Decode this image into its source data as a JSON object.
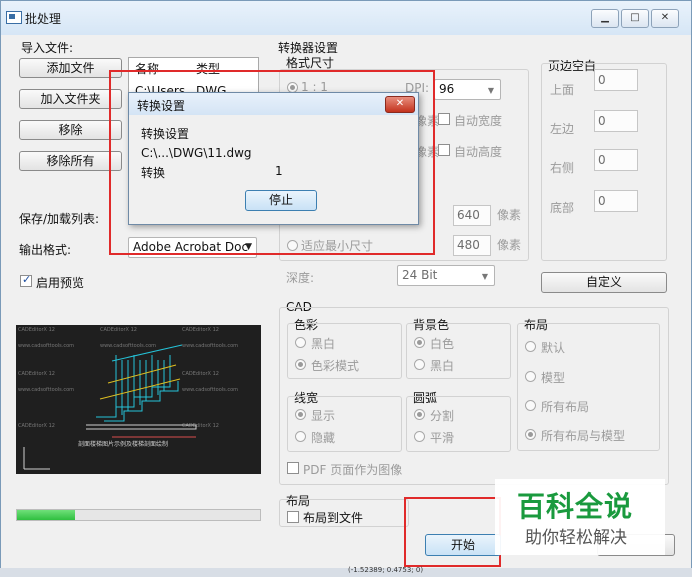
{
  "window": {
    "title": "批处理"
  },
  "import": {
    "section_label": "导入文件:",
    "add_file": "添加文件",
    "add_folder": "加入文件夹",
    "remove": "移除",
    "remove_all": "移除所有",
    "col_name": "名称",
    "col_type": "类型",
    "row_name": "C:\\Users",
    "row_type": "DWG"
  },
  "save_list_label": "保存/加载列表:",
  "output": {
    "label": "输出格式:",
    "value": "Adobe Acrobat Doc"
  },
  "preview_check": {
    "label": "启用预览",
    "checked": true
  },
  "progress": {
    "fraction": 0.24
  },
  "converter": {
    "section_label": "转换器设置",
    "format_size": "格式尺寸",
    "ratio_label": "1 : 1",
    "dpi_label": "DPI:",
    "dpi_value": "96",
    "px_label_1": "像素",
    "auto_width": "自动宽度",
    "px_label_2": "像素",
    "auto_height": "自动高度",
    "width_value": "640",
    "height_value": "480",
    "px_unit_w": "像素",
    "px_unit_h": "像素",
    "fit_min": "适应最小尺寸",
    "depth_label": "深度:",
    "depth_value": "24 Bit"
  },
  "margins": {
    "section_label": "页边空白",
    "top_label": "上面",
    "top_value": "0",
    "left_label": "左边",
    "left_value": "0",
    "right_label": "右侧",
    "right_value": "0",
    "bottom_label": "底部",
    "bottom_value": "0",
    "custom_button": "自定义"
  },
  "cad": {
    "section_label": "CAD",
    "color_label": "色彩",
    "black_white": "黑白",
    "color_mode": "色彩模式",
    "bg_label": "背景色",
    "bg_white": "白色",
    "bg_black": "黑白",
    "layout_label": "布局",
    "layout_default": "默认",
    "layout_model": "模型",
    "layout_all": "所有布局",
    "layout_all_model": "所有布局与模型",
    "lineweight_label": "线宽",
    "lw_show": "显示",
    "lw_hide": "隐藏",
    "arc_label": "圆弧",
    "arc_split": "分割",
    "arc_smooth": "平滑",
    "pdf_pages": "PDF 页面作为图像"
  },
  "layout_section": {
    "label": "布局",
    "layout_to_file": "布局到文件"
  },
  "start_button": "开始",
  "dialog": {
    "title": "转换设置",
    "line1": "转换设置",
    "line2": "C:\\...\\DWG\\11.dwg",
    "convert_label": "转换",
    "convert_count": "1",
    "stop_button": "停止"
  },
  "watermark": {
    "main": "百科全说",
    "sub": "助你轻松解决"
  },
  "preview_texts": {
    "cad_label": "CADEditorX 12",
    "site": "www.cadsofttools.com",
    "caption": "剖面楼梯图片示例及楼梯剖面绘制"
  },
  "taskbar": {
    "coords": "(-1.52389; 0.4753; 0)"
  },
  "colors": {
    "red_highlight": "#e02a2a",
    "watermark_green": "#1a9a3e",
    "progress_green": "#2fbf3f",
    "cad_cyan": "#25c3d8"
  }
}
